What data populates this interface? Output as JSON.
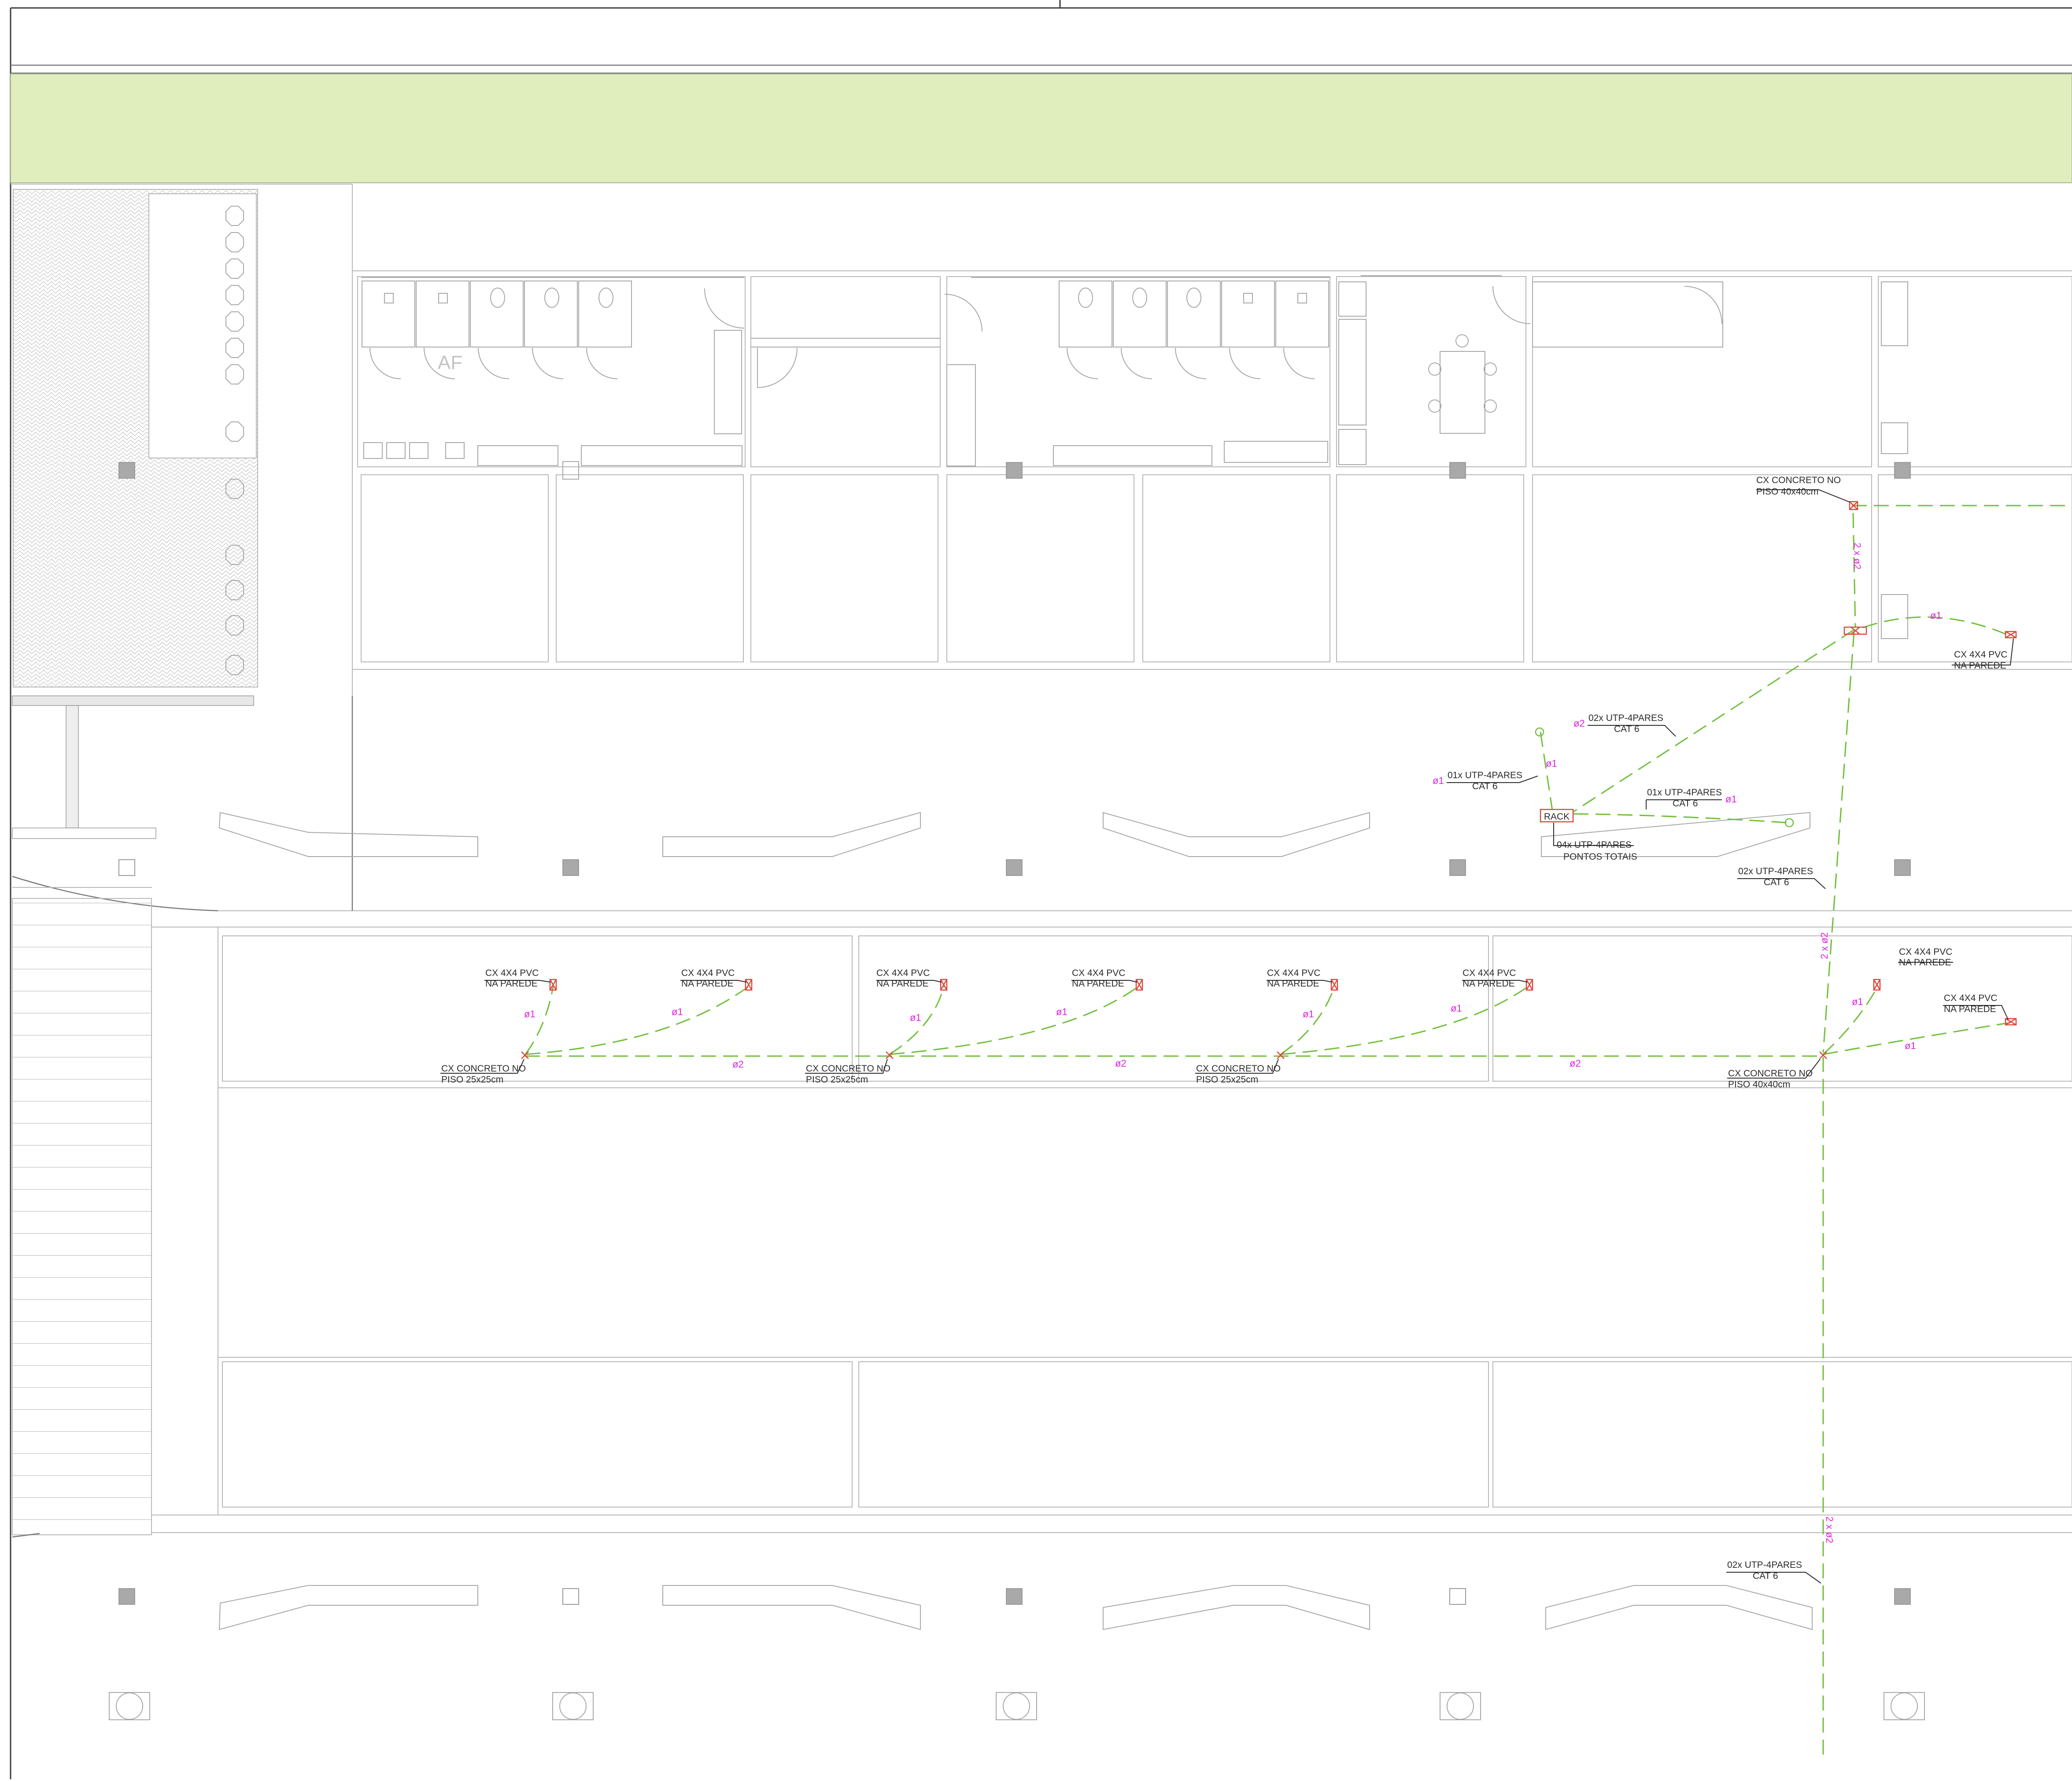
{
  "colors": {
    "strip_green": "#e0eebd",
    "conduit_green": "#6fbf3a",
    "pipe_magenta": "#e024e0",
    "box_red": "#e0443c",
    "wall_gray": "#b8b8b8",
    "pillar_gray": "#a9a9a9"
  },
  "room_tag": "AF",
  "rack": {
    "label": "RACK"
  },
  "floor_boxes": [
    {
      "line1": "CX CONCRETO NO",
      "line2": "PISO 40x40cm"
    },
    {
      "line1": "CX CONCRETO NO",
      "line2": "PISO 25x25cm"
    },
    {
      "line1": "CX CONCRETO NO",
      "line2": "PISO 25x25cm"
    },
    {
      "line1": "CX CONCRETO NO",
      "line2": "PISO 25x25cm"
    },
    {
      "line1": "CX CONCRETO NO",
      "line2": "PISO 40x40cm"
    }
  ],
  "wall_boxes": [
    {
      "line1": "CX 4X4 PVC",
      "line2": "NA PAREDE"
    },
    {
      "line1": "CX 4X4 PVC",
      "line2": "NA PAREDE"
    },
    {
      "line1": "CX 4X4 PVC",
      "line2": "NA PAREDE"
    },
    {
      "line1": "CX 4X4 PVC",
      "line2": "NA PAREDE"
    },
    {
      "line1": "CX 4X4 PVC",
      "line2": "NA PAREDE"
    },
    {
      "line1": "CX 4X4 PVC",
      "line2": "NA PAREDE"
    },
    {
      "line1": "CX 4X4 PVC",
      "line2": "NA PAREDE"
    },
    {
      "line1": "CX 4X4 PVC",
      "line2": "NA PAREDE"
    },
    {
      "line1": "CX 4X4 PVC",
      "line2": "NA PAREDE"
    }
  ],
  "cable_labels": [
    {
      "line1": "02x UTP-4PARES",
      "line2": "CAT 6"
    },
    {
      "line1": "01x UTP-4PARES",
      "line2": "CAT 6"
    },
    {
      "line1": "01x UTP-4PARES",
      "line2": "CAT 6"
    },
    {
      "line1": "04x UTP-4PARES",
      "line2": "PONTOS TOTAIS"
    },
    {
      "line1": "02x UTP-4PARES",
      "line2": "CAT 6"
    },
    {
      "line1": "02x UTP-4PARES",
      "line2": "CAT 6"
    }
  ],
  "pipe_sizes": {
    "d1": "ø1",
    "d2": "ø2",
    "double_d2": "2 x ø2"
  }
}
